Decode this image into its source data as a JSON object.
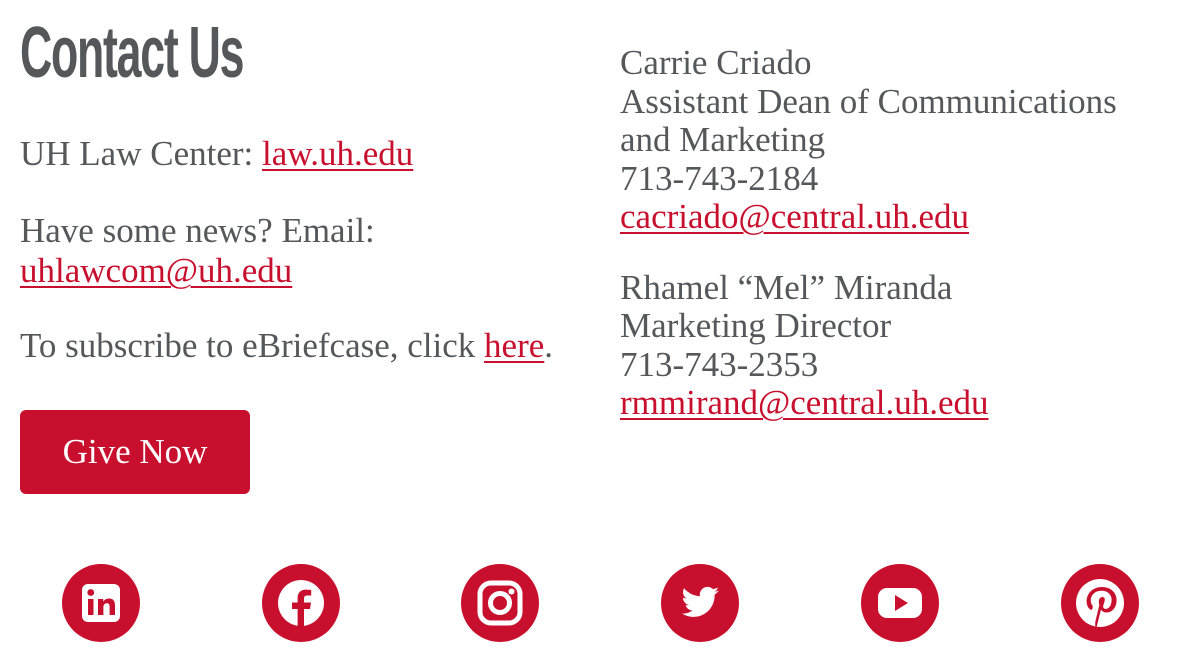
{
  "page": {
    "title": "Contact Us"
  },
  "general": {
    "law_center_label": "UH Law Center: ",
    "law_center_link": "law.uh.edu",
    "news_label": "Have some news? Email:",
    "news_email": "uhlawcom@uh.edu",
    "subscribe_label": "To subscribe to eBriefcase, click ",
    "subscribe_link": "here",
    "subscribe_period": ".",
    "give_button": "Give Now"
  },
  "contacts": [
    {
      "name": "Carrie Criado",
      "title_line1": "Assistant Dean of Communications",
      "title_line2": "and Marketing",
      "phone": "713-743-2184",
      "email": "cacriado@central.uh.edu"
    },
    {
      "name": "Rhamel “Mel” Miranda",
      "title_line1": "Marketing Director",
      "phone": "713-743-2353",
      "email": "rmmirand@central.uh.edu"
    }
  ],
  "social": {
    "color": "#c8102e",
    "icons": [
      "linkedin-icon",
      "facebook-icon",
      "instagram-icon",
      "twitter-icon",
      "youtube-icon",
      "pinterest-icon"
    ]
  },
  "colors": {
    "text": "#54585a",
    "accent": "#c8102e",
    "button_text": "#ffffff"
  }
}
